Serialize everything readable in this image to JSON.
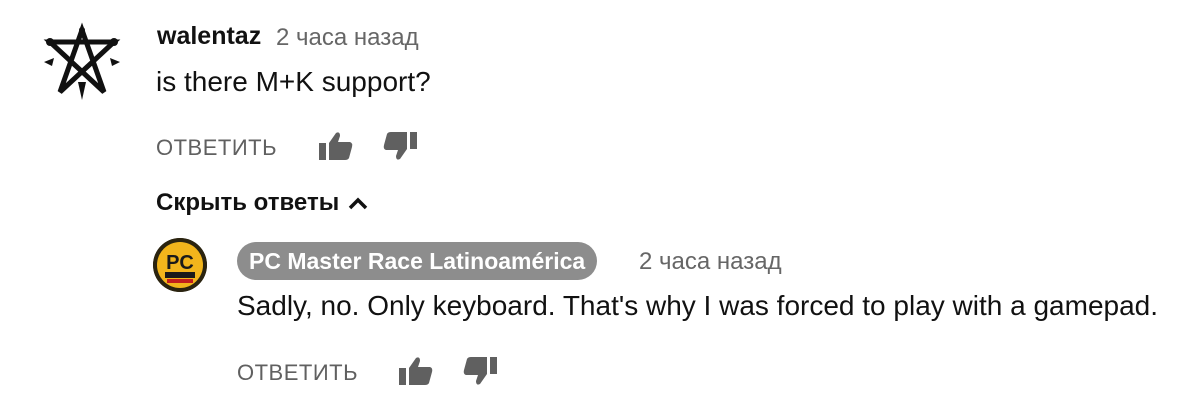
{
  "comment": {
    "author": "walentaz",
    "time": "2 часа назад",
    "text": "is there M+K support?",
    "reply_label": "ОТВЕТИТЬ",
    "like_icon": "thumbs-up-icon",
    "dislike_icon": "thumbs-down-icon",
    "avatar_icon": "pentagram-icon"
  },
  "replies_toggle": {
    "label": "Скрыть ответы",
    "icon": "chevron-up-icon"
  },
  "reply": {
    "author": "PC Master Race Latinoamérica",
    "time": "2 часа назад",
    "text": "Sadly, no. Only keyboard. That's why I was forced to play with a gamepad.",
    "reply_label": "ОТВЕТИТЬ",
    "avatar_text": "PC",
    "like_icon": "thumbs-up-icon",
    "dislike_icon": "thumbs-down-icon"
  },
  "colors": {
    "text": "#111111",
    "muted": "#606060",
    "chip_bg": "#8d8d8d",
    "avatar_yellow": "#f2b51c"
  }
}
